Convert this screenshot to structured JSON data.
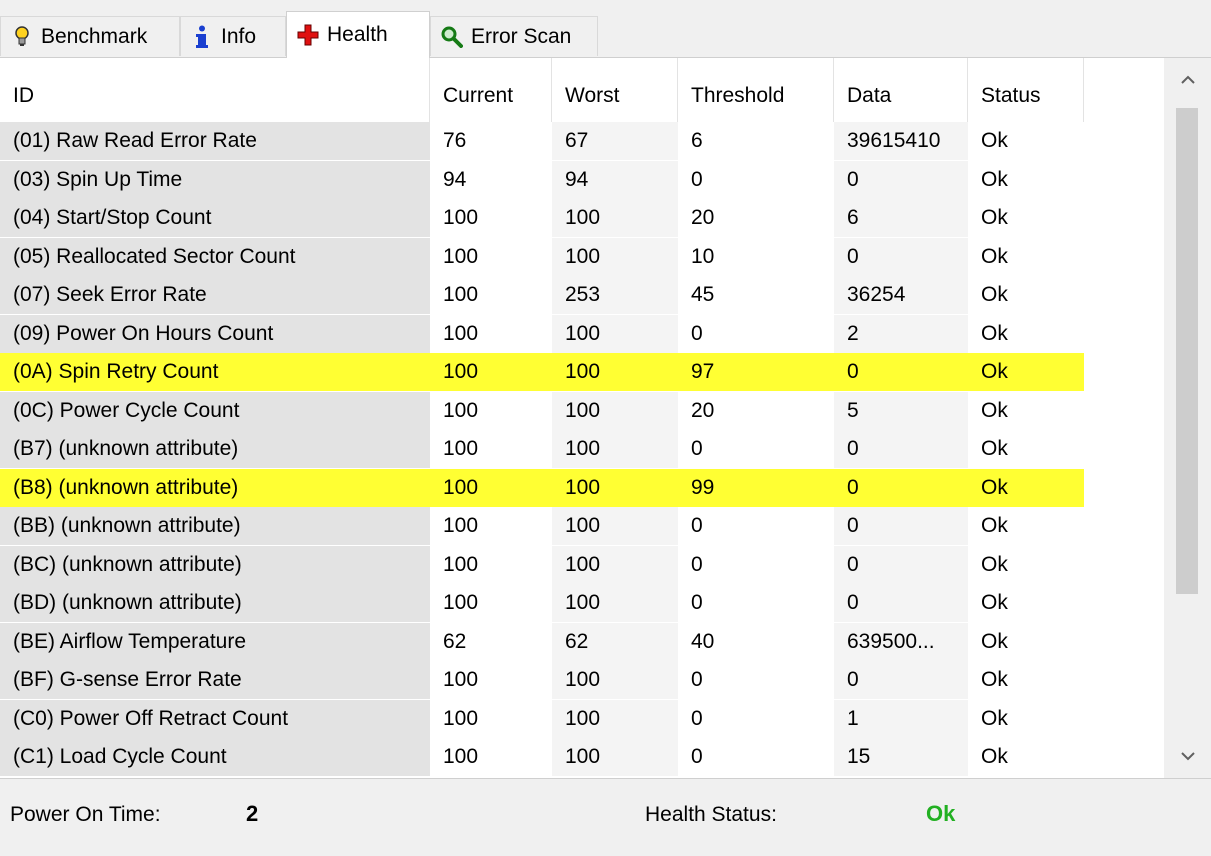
{
  "tabs": [
    {
      "label": "Benchmark",
      "icon": "lightbulb-icon"
    },
    {
      "label": "Info",
      "icon": "info-icon"
    },
    {
      "label": "Health",
      "icon": "red-cross-icon"
    },
    {
      "label": "Error Scan",
      "icon": "magnifier-icon"
    }
  ],
  "table": {
    "headers": [
      "ID",
      "Current",
      "Worst",
      "Threshold",
      "Data",
      "Status"
    ],
    "rows": [
      {
        "id": "(01) Raw Read Error Rate",
        "current": "76",
        "worst": "67",
        "threshold": "6",
        "data": "39615410",
        "status": "Ok",
        "highlighted": false
      },
      {
        "id": "(03) Spin Up Time",
        "current": "94",
        "worst": "94",
        "threshold": "0",
        "data": "0",
        "status": "Ok",
        "highlighted": false
      },
      {
        "id": "(04) Start/Stop Count",
        "current": "100",
        "worst": "100",
        "threshold": "20",
        "data": "6",
        "status": "Ok",
        "highlighted": false
      },
      {
        "id": "(05) Reallocated Sector Count",
        "current": "100",
        "worst": "100",
        "threshold": "10",
        "data": "0",
        "status": "Ok",
        "highlighted": false
      },
      {
        "id": "(07) Seek Error Rate",
        "current": "100",
        "worst": "253",
        "threshold": "45",
        "data": "36254",
        "status": "Ok",
        "highlighted": false
      },
      {
        "id": "(09) Power On Hours Count",
        "current": "100",
        "worst": "100",
        "threshold": "0",
        "data": "2",
        "status": "Ok",
        "highlighted": false
      },
      {
        "id": "(0A) Spin Retry Count",
        "current": "100",
        "worst": "100",
        "threshold": "97",
        "data": "0",
        "status": "Ok",
        "highlighted": true
      },
      {
        "id": "(0C) Power Cycle Count",
        "current": "100",
        "worst": "100",
        "threshold": "20",
        "data": "5",
        "status": "Ok",
        "highlighted": false
      },
      {
        "id": "(B7) (unknown attribute)",
        "current": "100",
        "worst": "100",
        "threshold": "0",
        "data": "0",
        "status": "Ok",
        "highlighted": false
      },
      {
        "id": "(B8) (unknown attribute)",
        "current": "100",
        "worst": "100",
        "threshold": "99",
        "data": "0",
        "status": "Ok",
        "highlighted": true
      },
      {
        "id": "(BB) (unknown attribute)",
        "current": "100",
        "worst": "100",
        "threshold": "0",
        "data": "0",
        "status": "Ok",
        "highlighted": false
      },
      {
        "id": "(BC) (unknown attribute)",
        "current": "100",
        "worst": "100",
        "threshold": "0",
        "data": "0",
        "status": "Ok",
        "highlighted": false
      },
      {
        "id": "(BD) (unknown attribute)",
        "current": "100",
        "worst": "100",
        "threshold": "0",
        "data": "0",
        "status": "Ok",
        "highlighted": false
      },
      {
        "id": "(BE) Airflow Temperature",
        "current": "62",
        "worst": "62",
        "threshold": "40",
        "data": "639500...",
        "status": "Ok",
        "highlighted": false
      },
      {
        "id": "(BF) G-sense Error Rate",
        "current": "100",
        "worst": "100",
        "threshold": "0",
        "data": "0",
        "status": "Ok",
        "highlighted": false
      },
      {
        "id": "(C0) Power Off Retract Count",
        "current": "100",
        "worst": "100",
        "threshold": "0",
        "data": "1",
        "status": "Ok",
        "highlighted": false
      },
      {
        "id": "(C1) Load Cycle Count",
        "current": "100",
        "worst": "100",
        "threshold": "0",
        "data": "15",
        "status": "Ok",
        "highlighted": false
      }
    ]
  },
  "footer": {
    "power_on_label": "Power On Time:",
    "power_on_value": "2",
    "health_label": "Health Status:",
    "health_value": "Ok"
  },
  "colors": {
    "highlight": "#ffff33",
    "ok_green": "#22b022",
    "id_column_bg": "#e3e3e3"
  }
}
